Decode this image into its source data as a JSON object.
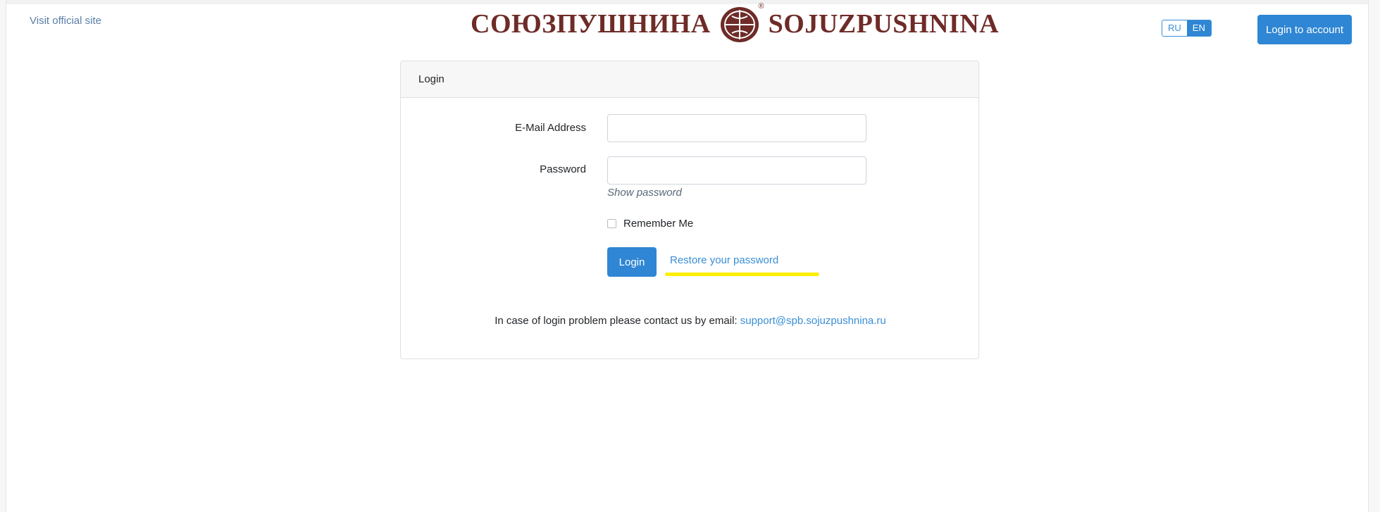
{
  "header": {
    "visit_site_label": "Visit official site",
    "logo_ru": "СОЮЗПУШНИНА",
    "logo_en": "SOJUZPUSHNINA",
    "logo_registered": "®",
    "lang_options": [
      "RU",
      "EN"
    ],
    "active_lang": "EN",
    "login_account_label": "Login to account"
  },
  "login_card": {
    "title": "Login",
    "email_label": "E-Mail Address",
    "email_value": "",
    "password_label": "Password",
    "password_value": "",
    "show_password_label": "Show password",
    "remember_label": "Remember Me",
    "remember_checked": false,
    "login_button_label": "Login",
    "restore_label": "Restore your password",
    "help_text": "In case of login problem please contact us by email: ",
    "help_email": "support@spb.sojuzpushnina.ru"
  },
  "colors": {
    "primary": "#2f86d4",
    "brand": "#6e2b27",
    "highlight": "#ffee00"
  }
}
